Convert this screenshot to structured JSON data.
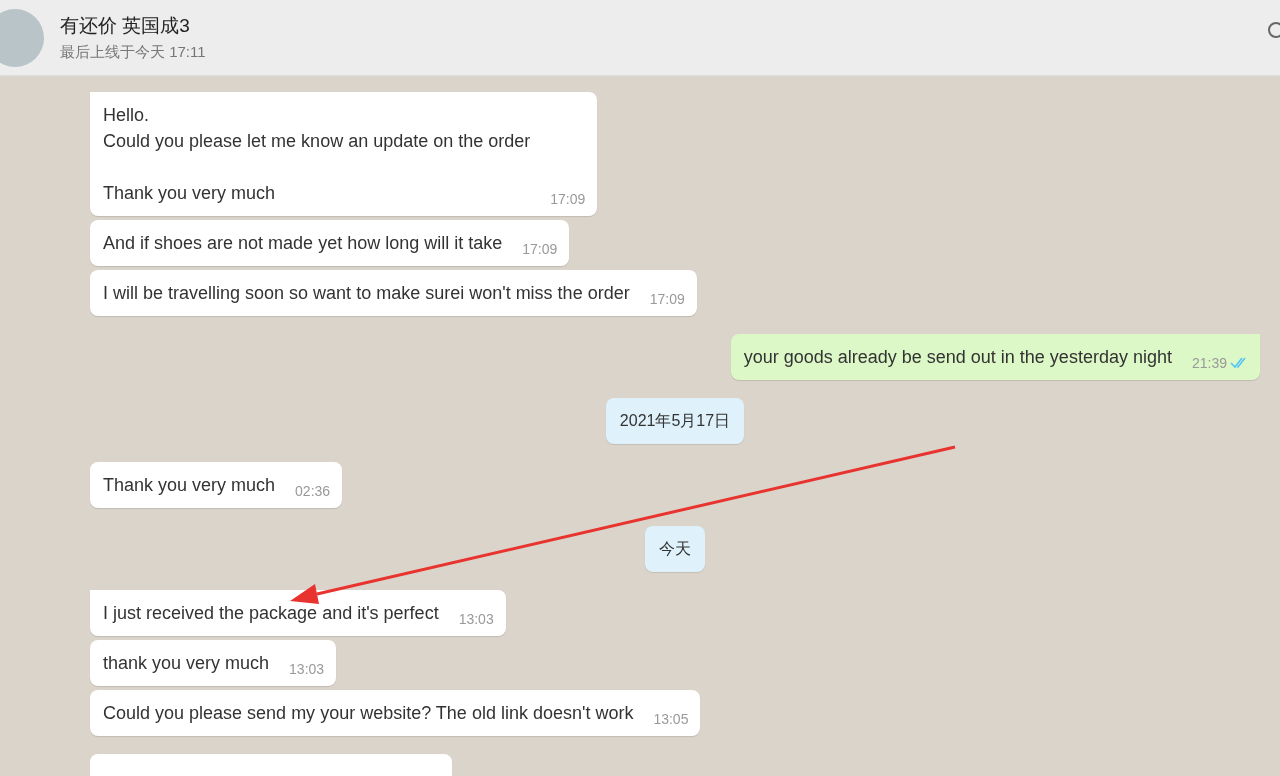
{
  "header": {
    "name": "有还价 英国成3",
    "status": "最后上线于今天 17:11"
  },
  "messages": [
    {
      "kind": "in",
      "tail": true,
      "text": "Hello.\nCould you please let me know an update on the order\n\nThank you very much",
      "time": "17:09"
    },
    {
      "kind": "in",
      "tail": false,
      "text": "And if shoes are not made yet how long will it take",
      "time": "17:09"
    },
    {
      "kind": "in",
      "tail": false,
      "text": "I will be travelling soon so want to make surei won't miss the order",
      "time": "17:09"
    },
    {
      "kind": "out",
      "tail": true,
      "text": "your goods already be send out in the yesterday night",
      "time": "21:39",
      "read": true
    },
    {
      "kind": "date",
      "text": "2021年5月17日"
    },
    {
      "kind": "in",
      "tail": false,
      "text": "Thank you very much",
      "time": "02:36"
    },
    {
      "kind": "date",
      "text": "今天"
    },
    {
      "kind": "in",
      "tail": true,
      "text": "I just received the package and it's perfect",
      "time": "13:03"
    },
    {
      "kind": "in",
      "tail": false,
      "text": "thank you very much",
      "time": "13:03"
    },
    {
      "kind": "in",
      "tail": false,
      "text": "Could you please send my your website? The old link doesn't work",
      "time": "13:05"
    },
    {
      "kind": "cut"
    }
  ]
}
